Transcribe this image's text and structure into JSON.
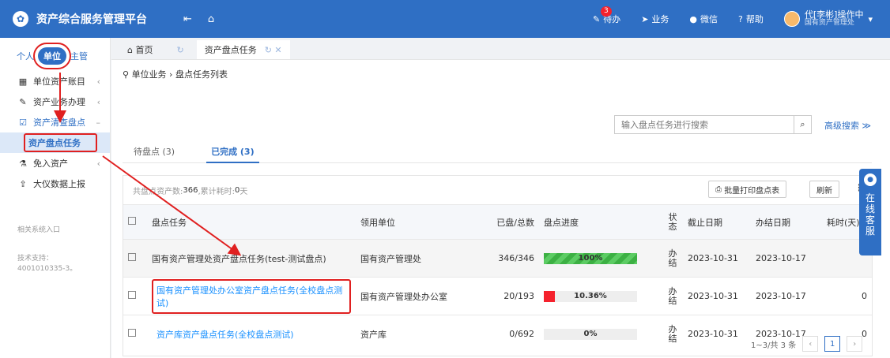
{
  "topbar": {
    "title": "资产综合服务管理平台",
    "collapse_icon": "collapse-icon",
    "home_icon": "home-icon",
    "todo_label": "待办",
    "todo_badge": "3",
    "business_label": "业务",
    "wechat_label": "微信",
    "help_label": "帮助",
    "user_name": "代[李彬]操作中",
    "user_dept": "国有资产管理处",
    "bg_color": "#2f6fc4"
  },
  "sidebar": {
    "roles": [
      "个人",
      "单位",
      "主管"
    ],
    "active_role": "单位",
    "items": [
      {
        "label": "单位资产账目",
        "icon": "grid-icon"
      },
      {
        "label": "资产业务办理",
        "icon": "pen-icon"
      },
      {
        "label": "资产清查盘点",
        "icon": "check-icon"
      },
      {
        "label": "资产盘点任务"
      },
      {
        "label": "免入资产",
        "icon": "flask-icon"
      },
      {
        "label": "大仪数据上报",
        "icon": "upload-icon"
      }
    ],
    "related": "相关系统入口",
    "support": "技术支持：4001010335-3。"
  },
  "tabs": {
    "home": "首页",
    "current": "资产盘点任务"
  },
  "breadcrumb": "单位业务 › 盘点任务列表",
  "search": {
    "placeholder": "输入盘点任务进行搜索",
    "advanced": "高级搜索 ≫"
  },
  "status_tabs": {
    "pending": "待盘点 (3)",
    "done": "已完成 (3)"
  },
  "panel": {
    "summary_prefix": "共盘点资产数:",
    "summary_count": "366",
    "summary_mid": ",累计耗时:",
    "summary_time": "0",
    "summary_unit": "天",
    "batch_print": "批量打印盘点表",
    "refresh": "刷新"
  },
  "table": {
    "headers": [
      "盘点任务",
      "领用单位",
      "已盘/总数",
      "盘点进度",
      "状态",
      "截止日期",
      "办结日期",
      "耗时(天)"
    ],
    "rows": [
      {
        "task": "国有资产管理处资产盘点任务(test-测试盘点)",
        "unit": "国有资产管理处",
        "ratio": "346/346",
        "progress": 100,
        "progress_text": "100%",
        "status": "办结",
        "deadline": "2023-10-31",
        "finish": "2023-10-17",
        "days": ""
      },
      {
        "task": "国有资产管理处办公室资产盘点任务(全校盘点测试)",
        "unit": "国有资产管理处办公室",
        "ratio": "20/193",
        "progress": 10.36,
        "progress_text": "10.36%",
        "status": "办结",
        "deadline": "2023-10-31",
        "finish": "2023-10-17",
        "days": "0"
      },
      {
        "task": "资产库资产盘点任务(全校盘点测试)",
        "unit": "资产库",
        "ratio": "0/692",
        "progress": 0,
        "progress_text": "0%",
        "status": "办结",
        "deadline": "2023-10-31",
        "finish": "2023-10-17",
        "days": "0"
      }
    ]
  },
  "pager": {
    "summary": "1~3/共 3 条",
    "current": "1"
  },
  "customer_service": "在线客服",
  "colors": {
    "progress_full": "#3cb043",
    "progress_low": "#f5222d",
    "annotation": "#e02020"
  }
}
